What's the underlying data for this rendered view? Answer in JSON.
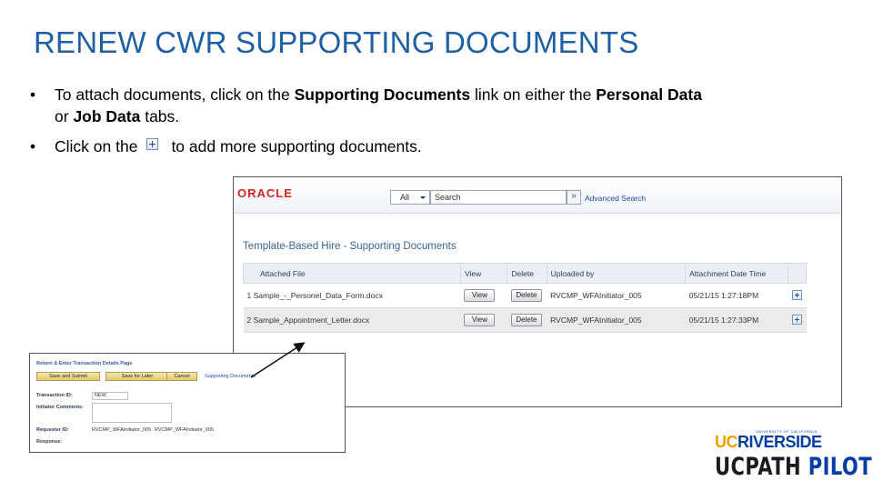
{
  "slide": {
    "title": "RENEW CWR SUPPORTING DOCUMENTS",
    "bullet_char": "•",
    "bullet1": {
      "t1": "To attach documents, click on the ",
      "b1": "Supporting Documents",
      "t2": " link on either the ",
      "b2": "Personal Data",
      "t3": " or ",
      "b3": "Job Data",
      "t4": " tabs."
    },
    "bullet2": {
      "t1": "Click on the",
      "t2": "to add more supporting documents."
    }
  },
  "screenshot": {
    "brand": "ORACLE",
    "scope_value": "All",
    "search_placeholder": "Search",
    "go_symbol": "»",
    "advanced_search": "Advanced Search",
    "page_title": "Template-Based Hire - Supporting Documents",
    "table": {
      "headers": {
        "attached_file": "Attached File",
        "view": "View",
        "delete": "Delete",
        "uploaded_by": "Uploaded by",
        "attachment_datetime": "Attachment Date Time"
      },
      "rows": [
        {
          "num": "1",
          "file": "Sample_-_Personel_Data_Form.docx",
          "view": "View",
          "delete": "Delete",
          "uploaded_by": "RVCMP_WFAInitiator_005",
          "datetime": "05/21/15 1:27:18PM"
        },
        {
          "num": "2",
          "file": "Sample_Appointment_Letter.docx",
          "view": "View",
          "delete": "Delete",
          "uploaded_by": "RVCMP_WFAInitiator_005",
          "datetime": "05/21/15 1:27:33PM"
        }
      ]
    }
  },
  "inset": {
    "title": "Return & Enter Transaction Details Page",
    "save_submit": "Save and Submit",
    "save_later": "Save for Later",
    "cancel": "Cancel",
    "supporting_link": "Supporting Documents",
    "transaction_id_label": "Transaction ID:",
    "transaction_id_value": "NEW",
    "initiator_comments_label": "Initiator Comments:",
    "requester_id_label": "Requester ID:",
    "requester_id_value": "RVCMP_WFAInitiator_005",
    "requester_name_value": "RVCMP_WFAInitiator_005",
    "response_label": "Response:"
  },
  "logo": {
    "uc": "UC",
    "riverside": "RIVERSIDE",
    "university_tag": "UNIVERSITY OF CALIFORNIA",
    "ucpath": "UCPATH",
    "pilot": "PILOT"
  },
  "colors": {
    "title_blue": "#1f5fa6",
    "oracle_red": "#d0271d",
    "link_blue": "#1b4aa3",
    "uc_gold": "#e8a400",
    "ucr_blue": "#003da5"
  }
}
